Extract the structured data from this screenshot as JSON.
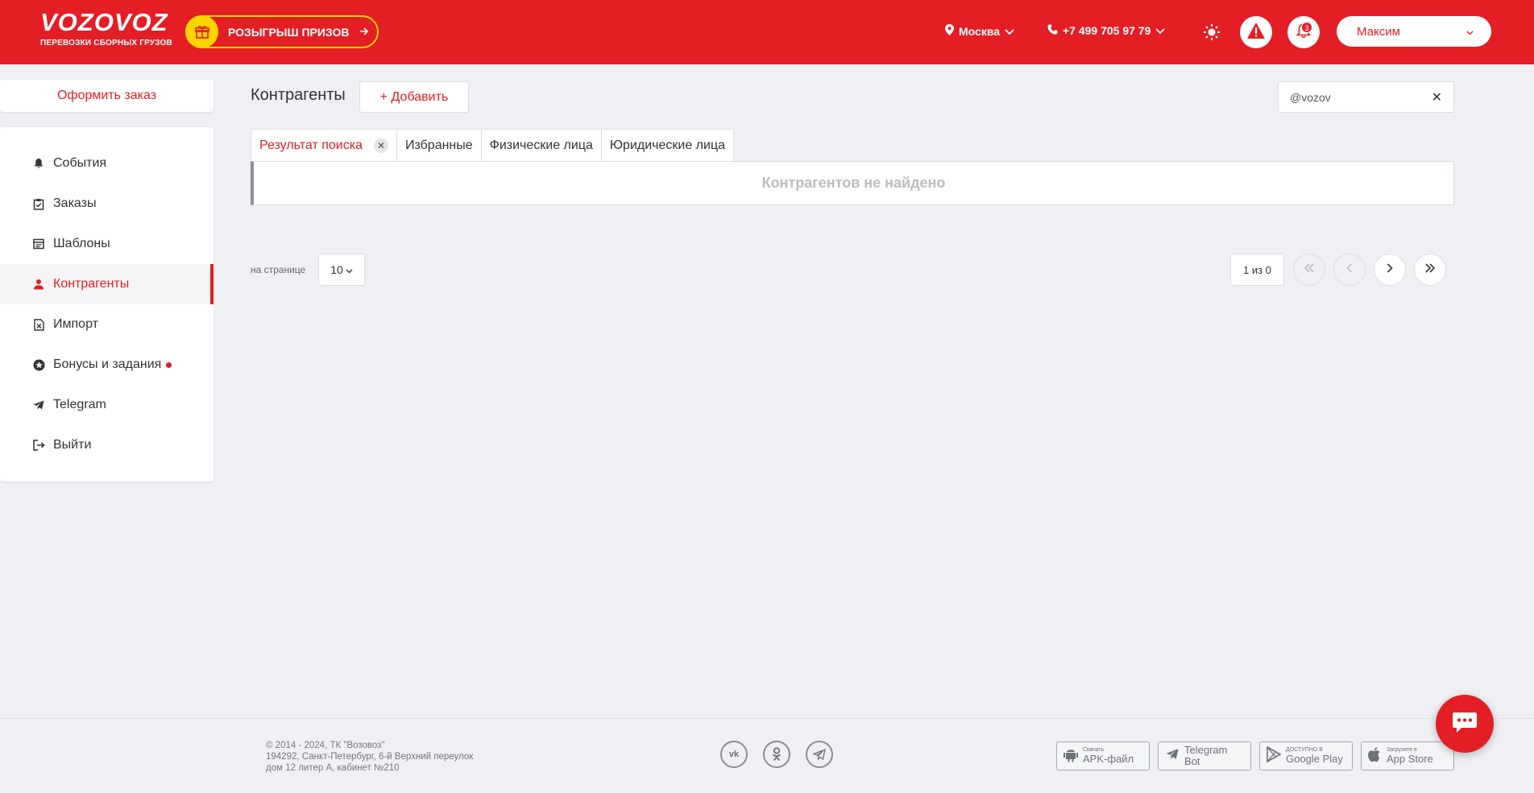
{
  "brand": {
    "logo": "VOZOVOZ",
    "tagline": "ПЕРЕВОЗКИ СБОРНЫХ ГРУЗОВ",
    "accent": "#e31e24",
    "prize_color": "#ffd400"
  },
  "header": {
    "prize_label": "РОЗЫГРЫШ ПРИЗОВ",
    "city": "Москва",
    "phone": "+7 499 705 97 79",
    "notifications_count": "3",
    "user_name": "Максим"
  },
  "sidebar": {
    "order_button": "Оформить заказ",
    "items": [
      {
        "label": "События",
        "icon": "bell-icon"
      },
      {
        "label": "Заказы",
        "icon": "clipboard-icon"
      },
      {
        "label": "Шаблоны",
        "icon": "template-icon"
      },
      {
        "label": "Контрагенты",
        "icon": "person-icon",
        "active": true
      },
      {
        "label": "Импорт",
        "icon": "excel-file-icon"
      },
      {
        "label": "Бонусы и задания",
        "icon": "star-badge-icon"
      },
      {
        "label": "Telegram",
        "icon": "telegram-icon"
      },
      {
        "label": "Выйти",
        "icon": "logout-icon"
      }
    ]
  },
  "main": {
    "title": "Контрагенты",
    "add_button": "+ Добавить",
    "search_value": "@vozov",
    "tabs": [
      {
        "label": "Результат поиска",
        "active": true
      },
      {
        "label": "Избранные"
      },
      {
        "label": "Физические лица"
      },
      {
        "label": "Юридические лица"
      }
    ],
    "empty_message": "Контрагентов не найдено",
    "per_page_label": "на странице",
    "per_page_value": "10",
    "page_info": "1 из 0"
  },
  "footer": {
    "copyright_line1": "© 2014 - 2024, ТК \"Возовоз\"",
    "copyright_line2": "194292, Санкт-Петербург, 6-й Верхний переулок",
    "copyright_line3": "дом 12 литер А, кабинет №210",
    "socials": [
      "vk-icon",
      "odnoklassniki-icon",
      "telegram-icon"
    ],
    "apk_small": "Скачать",
    "apk_big": "APK-файл",
    "tgbot": "Telegram Bot",
    "gplay_small": "ДОСТУПНО В",
    "gplay_big": "Google Play",
    "appstore_small": "Загрузите в",
    "appstore_big": "App Store"
  }
}
